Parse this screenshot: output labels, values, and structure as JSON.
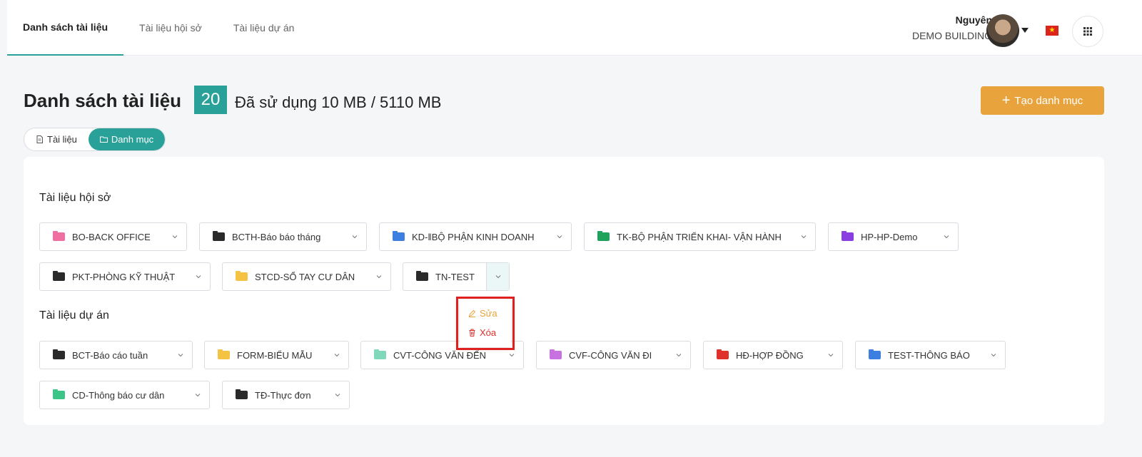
{
  "header": {
    "tabs": [
      {
        "label": "Danh sách tài liệu",
        "active": true
      },
      {
        "label": "Tài liệu hội sở",
        "active": false
      },
      {
        "label": "Tài liệu dự án",
        "active": false
      }
    ],
    "user_name": "Nguyên",
    "org_name": "DEMO BUILDING",
    "flag_star": "★",
    "avatar_icon": "avatar",
    "apps_icon": "grid-icon"
  },
  "page": {
    "title": "Danh sách tài liệu",
    "count": "20",
    "usage": "Đã sử dụng 10 MB / 5110 MB",
    "create_plus": "+",
    "create_label": "Tạo danh mục",
    "segment": {
      "doc_label": "Tài liệu",
      "folder_label": "Danh mục",
      "active": "Danh mục"
    }
  },
  "colors": {
    "accent": "#2aa198",
    "orange": "#e8a33d",
    "danger": "#e0302a"
  },
  "sections": [
    {
      "title": "Tài liệu hội sở",
      "items": [
        {
          "label": "BO-BACK OFFICE",
          "color": "#f06fa3"
        },
        {
          "label": "BCTH-Báo báo tháng",
          "color": "#2a2a2a"
        },
        {
          "label": "KD-‖BỘ PHẬN KINH DOANH",
          "color": "#3d7fe0"
        },
        {
          "label": "TK-BỘ PHẬN TRIỂN KHAI- VẬN HÀNH",
          "color": "#1fa35c"
        },
        {
          "label": "HP-HP-Demo",
          "color": "#8a3de0"
        },
        {
          "label": "PKT-PHÒNG KỸ THUẬT",
          "color": "#2a2a2a"
        },
        {
          "label": "STCD-SỔ TAY CƯ DÂN",
          "color": "#f5c343"
        },
        {
          "label": "TN-TEST",
          "color": "#2a2a2a",
          "open": true
        }
      ]
    },
    {
      "title": "Tài liệu dự án",
      "items": [
        {
          "label": "BCT-Báo cáo tuần",
          "color": "#2a2a2a"
        },
        {
          "label": "FORM-BIỂU MẪU",
          "color": "#f5c343"
        },
        {
          "label": "CVT-CÔNG VĂN ĐẾN",
          "color": "#7fd8b9"
        },
        {
          "label": "CVF-CÔNG VĂN ĐI",
          "color": "#c871e0"
        },
        {
          "label": "HĐ-HỢP ĐỒNG",
          "color": "#e0302a"
        },
        {
          "label": "TEST-THÔNG BÁO",
          "color": "#3d7fe0"
        },
        {
          "label": "CD-Thông báo cư dân",
          "color": "#3dc487"
        },
        {
          "label": "TĐ-Thực đơn",
          "color": "#2a2a2a"
        }
      ]
    }
  ],
  "dropdown": {
    "edit_label": "Sửa",
    "delete_label": "Xóa"
  }
}
